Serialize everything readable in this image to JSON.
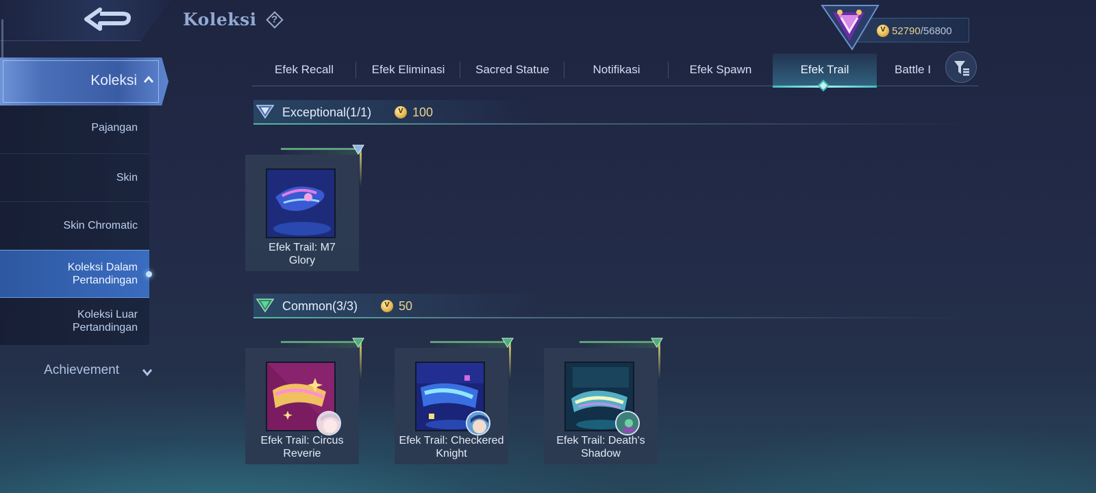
{
  "header": {
    "title": "Koleksi",
    "help": "?"
  },
  "currency": {
    "current": "52790",
    "max": "/56800"
  },
  "sidebar": {
    "main_label": "Koleksi",
    "items": [
      {
        "label": "Pajangan",
        "active": false
      },
      {
        "label": "Skin",
        "active": false
      },
      {
        "label": "Skin Chromatic",
        "active": false
      },
      {
        "label": "Koleksi Dalam Pertandingan",
        "active": true
      },
      {
        "label": "Koleksi Luar Pertandingan",
        "active": false
      }
    ],
    "achievement": "Achievement"
  },
  "tabs": [
    {
      "label": "Efek Recall",
      "active": false
    },
    {
      "label": "Efek Eliminasi",
      "active": false
    },
    {
      "label": "Sacred Statue",
      "active": false
    },
    {
      "label": "Notifikasi",
      "active": false
    },
    {
      "label": "Efek Spawn",
      "active": false
    },
    {
      "label": "Efek Trail",
      "active": true
    },
    {
      "label": "Battle I",
      "active": false
    }
  ],
  "sections": [
    {
      "title": "Exceptional(1/1)",
      "points": "100",
      "items": [
        {
          "name": "Efek Trail: M7 Glory",
          "colors": [
            "#1f2f8f",
            "#3e5fe0",
            "#d86ad9"
          ]
        }
      ]
    },
    {
      "title": "Common(3/3)",
      "points": "50",
      "items": [
        {
          "name": "Efek Trail: Circus Reverie",
          "colors": [
            "#8a1f6a",
            "#d24a9e",
            "#f1c46b"
          ]
        },
        {
          "name": "Efek Trail: Checkered Knight",
          "colors": [
            "#1b2a8a",
            "#3d6ee0",
            "#79d7ff"
          ]
        },
        {
          "name": "Efek Trail: Death's Shadow",
          "colors": [
            "#14304a",
            "#2e8a9a",
            "#c6f0d8"
          ]
        }
      ]
    }
  ]
}
